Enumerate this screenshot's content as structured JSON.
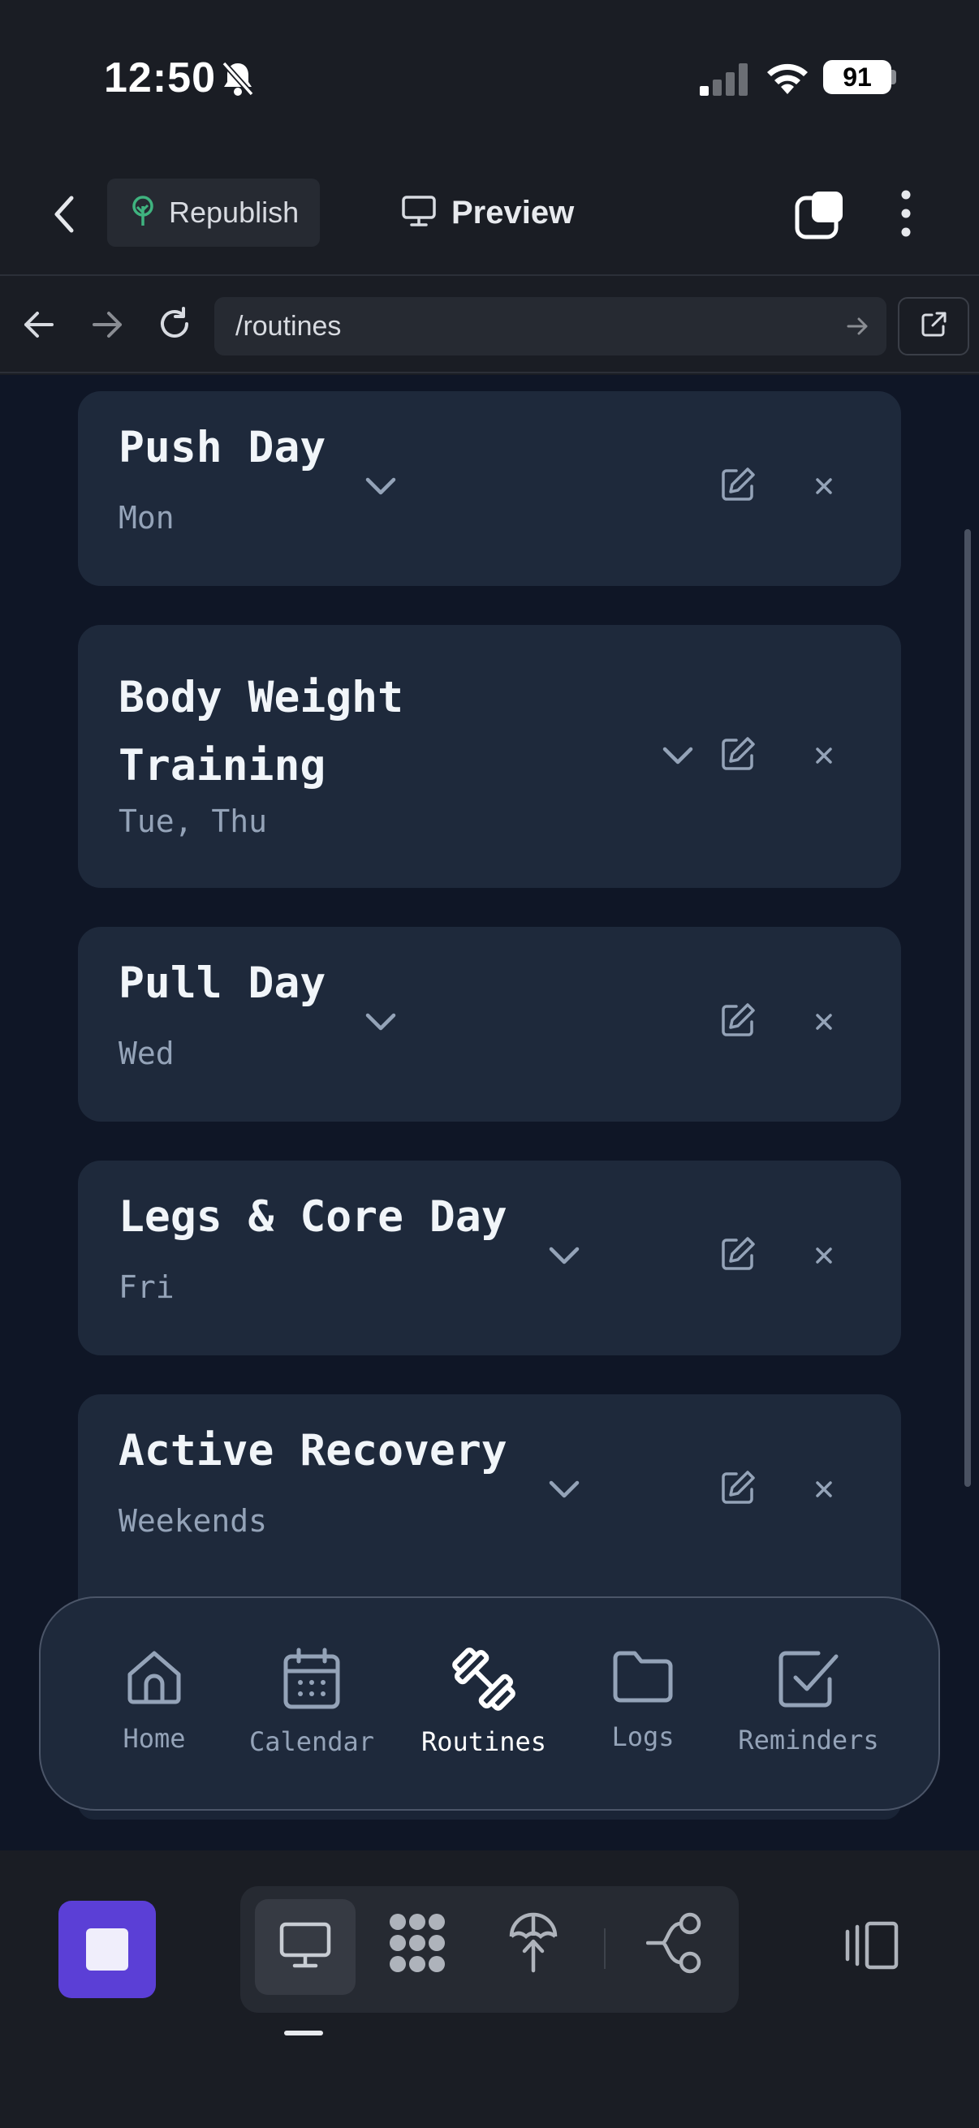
{
  "status_bar": {
    "time": "12:50",
    "battery": "91"
  },
  "toolbar": {
    "republish_label": "Republish",
    "preview_label": "Preview"
  },
  "url_bar": {
    "url": "/routines"
  },
  "routines": [
    {
      "name": "Push Day",
      "days": "Mon"
    },
    {
      "name_line1": "Body Weight",
      "name_line2": "Training",
      "days": "Tue, Thu"
    },
    {
      "name": "Pull Day",
      "days": "Wed"
    },
    {
      "name": "Legs & Core Day",
      "days": "Fri"
    },
    {
      "name": "Active Recovery",
      "days": "Weekends"
    }
  ],
  "app_nav": {
    "items": [
      {
        "label": "Home",
        "icon": "home-icon"
      },
      {
        "label": "Calendar",
        "icon": "calendar-icon"
      },
      {
        "label": "Routines",
        "icon": "dumbbell-icon",
        "active": true
      },
      {
        "label": "Logs",
        "icon": "folder-icon"
      },
      {
        "label": "Reminders",
        "icon": "checkbox-icon"
      }
    ]
  },
  "colors": {
    "app_background": "#0f1626",
    "card_background": "#1e293b",
    "stop_button": "#5b3fd6",
    "republish_icon": "#3fb37f"
  }
}
